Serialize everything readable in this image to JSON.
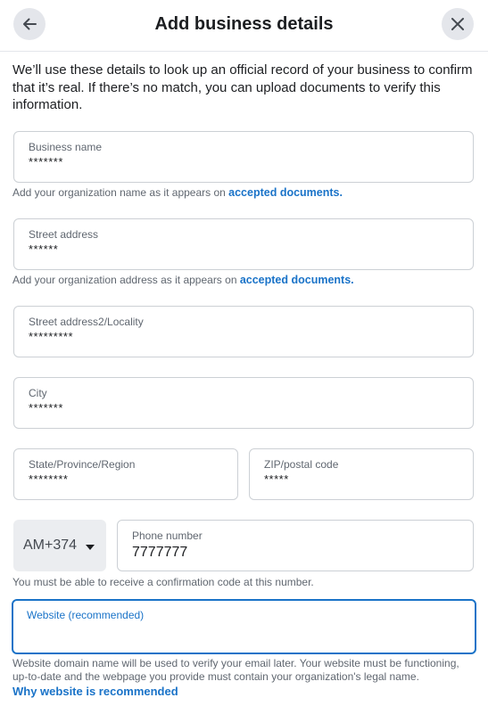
{
  "header": {
    "title": "Add business details",
    "back_icon": "arrow-left-icon",
    "close_icon": "close-icon"
  },
  "intro": "We’ll use these details to look up an official record of your business to confirm that it’s real. If there’s no match, you can upload documents to verify this information.",
  "fields": {
    "business_name": {
      "label": "Business name",
      "value": "*******"
    },
    "street_address": {
      "label": "Street address",
      "value": "******"
    },
    "street_address2": {
      "label": "Street address2/Locality",
      "value": "*********"
    },
    "city": {
      "label": "City",
      "value": "*******"
    },
    "state": {
      "label": "State/Province/Region",
      "value": "********"
    },
    "zip": {
      "label": "ZIP/postal code",
      "value": "*****"
    },
    "phone": {
      "label": "Phone number",
      "value": "7777777"
    },
    "website": {
      "label": "Website (recommended)",
      "value": ""
    }
  },
  "helpers": {
    "business_name": {
      "text": "Add your organization name as it appears on ",
      "link": "accepted documents."
    },
    "street_address": {
      "text": "Add your organization address as it appears on ",
      "link": "accepted documents."
    },
    "phone": "You must be able to receive a confirmation code at this number.",
    "website": "Website domain name will be used to verify your email later. Your website must be functioning, up-to-date and the webpage you provide must contain your organization's legal name.",
    "why_link": "Why website is recommended"
  },
  "country_code": {
    "value": "AM+374",
    "icon": "caret-down-icon"
  },
  "colors": {
    "link": "#1a73c8",
    "focus_border": "#1a73c8",
    "border": "#ccd0d5",
    "button_bg": "#e4e6eb"
  }
}
